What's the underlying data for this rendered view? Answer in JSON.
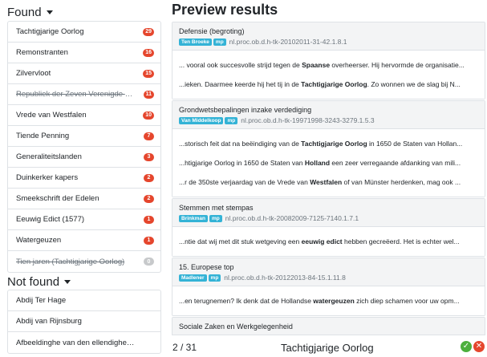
{
  "found": {
    "heading": "Found",
    "items": [
      {
        "label": "Tachtigjarige Oorlog",
        "count": "29",
        "struck": false
      },
      {
        "label": "Remonstranten",
        "count": "16",
        "struck": false
      },
      {
        "label": "Zilvervloot",
        "count": "15",
        "struck": false
      },
      {
        "label": "Republiek der Zeven Verenigde Ned...",
        "count": "11",
        "struck": true
      },
      {
        "label": "Vrede van Westfalen",
        "count": "10",
        "struck": false
      },
      {
        "label": "Tiende Penning",
        "count": "7",
        "struck": false
      },
      {
        "label": "Generaliteitslanden",
        "count": "3",
        "struck": false
      },
      {
        "label": "Duinkerker kapers",
        "count": "2",
        "struck": false
      },
      {
        "label": "Smeekschrift der Edelen",
        "count": "2",
        "struck": false
      },
      {
        "label": "Eeuwig Edict (1577)",
        "count": "1",
        "struck": false
      },
      {
        "label": "Watergeuzen",
        "count": "1",
        "struck": false
      },
      {
        "label": "Tien jaren (Tachtigjarige Oorlog)",
        "count": "0",
        "struck": true
      }
    ]
  },
  "not_found": {
    "heading": "Not found",
    "items": [
      {
        "label": "Abdij Ter Hage"
      },
      {
        "label": "Abdij van Rijnsburg"
      },
      {
        "label": "Afbeeldinghe van den ellendighen s..."
      }
    ]
  },
  "preview": {
    "title": "Preview results",
    "results": [
      {
        "title": "Defensie (begroting)",
        "person": "Ten Broeke",
        "party": "mp",
        "id": "nl.proc.ob.d.h-tk-20102011-31-42.1.8.1",
        "snippets": [
          {
            "before": "... vooral ook succesvolle strijd tegen de ",
            "term": "Spaanse",
            "after": " overheerser. Hij hervormde de organisatie..."
          },
          {
            "before": "...ieken. Daarmee keerde hij het tij in de ",
            "term": "Tachtigjarige Oorlog",
            "after": ". Zo wonnen we de slag bij N..."
          }
        ]
      },
      {
        "title": "Grondwetsbepalingen inzake verdediging",
        "person": "Van Middelkoop",
        "party": "mp",
        "id": "nl.proc.ob.d.h-tk-19971998-3243-3279.1.5.3",
        "snippets": [
          {
            "before": "...storisch feit dat na beëindiging van de ",
            "term": "Tachtigjarige Oorlog",
            "after": " in 1650 de Staten van Hollan..."
          },
          {
            "before": "...htigjarige Oorlog in 1650 de Staten van ",
            "term": "Holland",
            "after": " een zeer verregaande afdanking van mili..."
          },
          {
            "before": "...r de 350ste verjaardag van de Vrede van ",
            "term": "Westfalen",
            "after": " of van Münster herdenken, mag ook ..."
          }
        ]
      },
      {
        "title": "Stemmen met stempas",
        "person": "Brinkman",
        "party": "mp",
        "id": "nl.proc.ob.d.h-tk-20082009-7125-7140.1.7.1",
        "snippets": [
          {
            "before": "...ntie dat wij met dit stuk wetgeving een ",
            "term": "eeuwig edict",
            "after": " hebben gecreëerd. Het is echter wel..."
          }
        ]
      },
      {
        "title": "15. Europese top",
        "person": "Madlener",
        "party": "mp",
        "id": "nl.proc.ob.d.h-tk-20122013-84-15.1.11.8",
        "snippets": [
          {
            "before": "...en terugnemen? Ik denk dat de Hollandse ",
            "term": "watergeuzen",
            "after": " zich diep schamen voor uw opm..."
          }
        ]
      },
      {
        "title": "Sociale Zaken en Werkgelegenheid",
        "person": "",
        "party": "",
        "id": "",
        "snippets": []
      }
    ]
  },
  "footer": {
    "pager": "2 / 31",
    "current_term": "Tachtigjarige Oorlog",
    "accept_symbol": "✓",
    "reject_symbol": "✕"
  },
  "colors": {
    "badge": "#e5462d",
    "badge_zero": "#c7c9cb",
    "tag": "#34b3d6",
    "accept": "#4caf3d",
    "reject": "#e5462d"
  }
}
